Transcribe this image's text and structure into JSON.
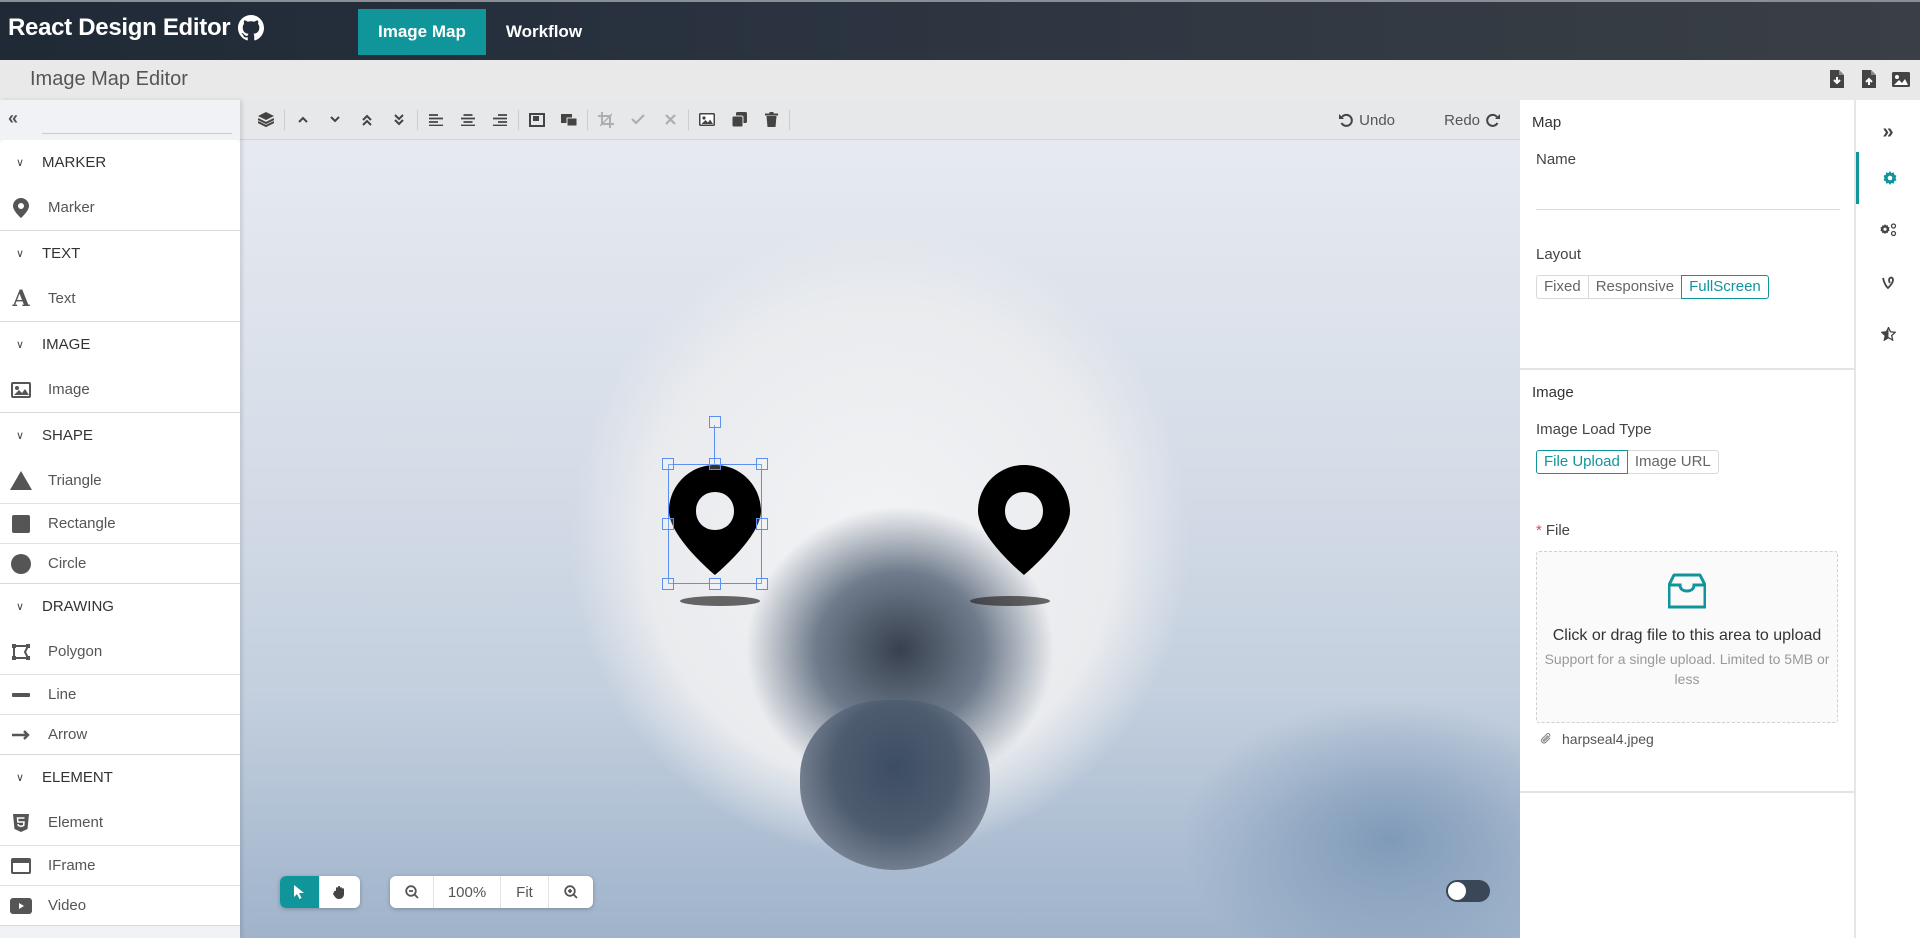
{
  "app": {
    "title": "React Design Editor",
    "nav": [
      {
        "label": "Image Map",
        "active": true
      },
      {
        "label": "Workflow",
        "active": false
      }
    ],
    "accent_color": "#10959b"
  },
  "titlebar": {
    "title": "Image Map Editor",
    "actions": [
      "file-download-icon",
      "file-upload-icon",
      "image-icon"
    ]
  },
  "left_panel": {
    "search_placeholder": "",
    "groups": [
      {
        "title": "MARKER",
        "items": [
          {
            "label": "Marker",
            "icon": "map-marker-icon"
          }
        ]
      },
      {
        "title": "TEXT",
        "items": [
          {
            "label": "Text",
            "icon": "font-icon"
          }
        ]
      },
      {
        "title": "IMAGE",
        "items": [
          {
            "label": "Image",
            "icon": "image-icon"
          }
        ]
      },
      {
        "title": "SHAPE",
        "items": [
          {
            "label": "Triangle",
            "icon": "triangle-icon"
          },
          {
            "label": "Rectangle",
            "icon": "square-icon"
          },
          {
            "label": "Circle",
            "icon": "circle-icon"
          }
        ]
      },
      {
        "title": "DRAWING",
        "items": [
          {
            "label": "Polygon",
            "icon": "polygon-icon"
          },
          {
            "label": "Line",
            "icon": "minus-icon"
          },
          {
            "label": "Arrow",
            "icon": "arrow-right-icon"
          }
        ]
      },
      {
        "title": "ELEMENT",
        "items": [
          {
            "label": "Element",
            "icon": "html5-icon"
          },
          {
            "label": "IFrame",
            "icon": "window-icon"
          },
          {
            "label": "Video",
            "icon": "video-icon"
          }
        ]
      }
    ]
  },
  "toolbar": {
    "undo_label": "Undo",
    "redo_label": "Redo"
  },
  "canvas": {
    "zoom_label": "100%",
    "fit_label": "Fit",
    "markers": 2,
    "selected_marker": 1
  },
  "properties": {
    "map_section": {
      "title": "Map",
      "name_label": "Name",
      "name_value": "",
      "layout_label": "Layout",
      "layout_options": [
        "Fixed",
        "Responsive",
        "FullScreen"
      ],
      "layout_selected": "FullScreen"
    },
    "image_section": {
      "title": "Image",
      "load_type_label": "Image Load Type",
      "load_type_options": [
        "File Upload",
        "Image URL"
      ],
      "load_type_selected": "File Upload",
      "file_label": "File",
      "upload_text": "Click or drag file to this area to upload",
      "upload_hint": "Support for a single upload. Limited to 5MB or less",
      "file_name": "harpseal4.jpeg"
    }
  },
  "right_rail": [
    "collapse-icon",
    "settings-icon",
    "animation-icon",
    "vine-icon",
    "star-icon"
  ]
}
